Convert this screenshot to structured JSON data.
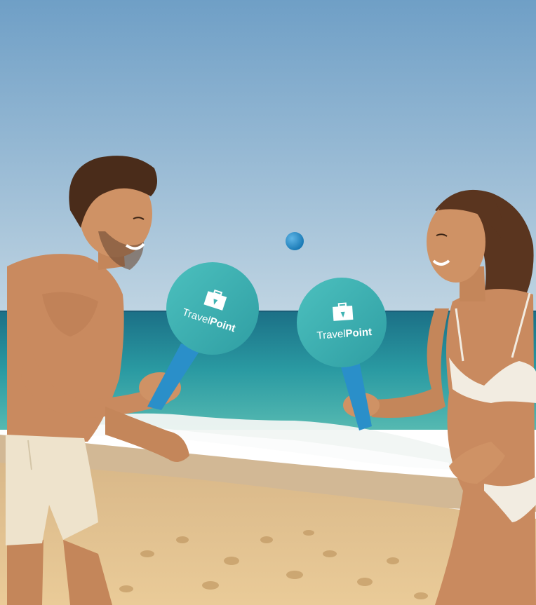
{
  "scene": {
    "colors": {
      "sky_top": "#6f9fc6",
      "sky_bottom": "#b9d0df",
      "sea_deep": "#1d7f8f",
      "sea_shallow": "#3aa9ad",
      "foam": "#f3f7f6",
      "sand": "#e6c794",
      "sand_dark": "#c89e62",
      "paddle_face": "#3fb3b3",
      "paddle_handle": "#2a8fc9",
      "ball": "#1e88c8",
      "skin": "#c98a5f",
      "hair": "#4a2c1a",
      "shorts": "#eee3cc",
      "bikini": "#f2ece1"
    },
    "paddles": [
      {
        "name": "left-paddle",
        "logo": {
          "brand_part1": "Travel",
          "brand_part2": "Point"
        }
      },
      {
        "name": "right-paddle",
        "logo": {
          "brand_part1": "Travel",
          "brand_part2": "Point"
        }
      }
    ]
  }
}
